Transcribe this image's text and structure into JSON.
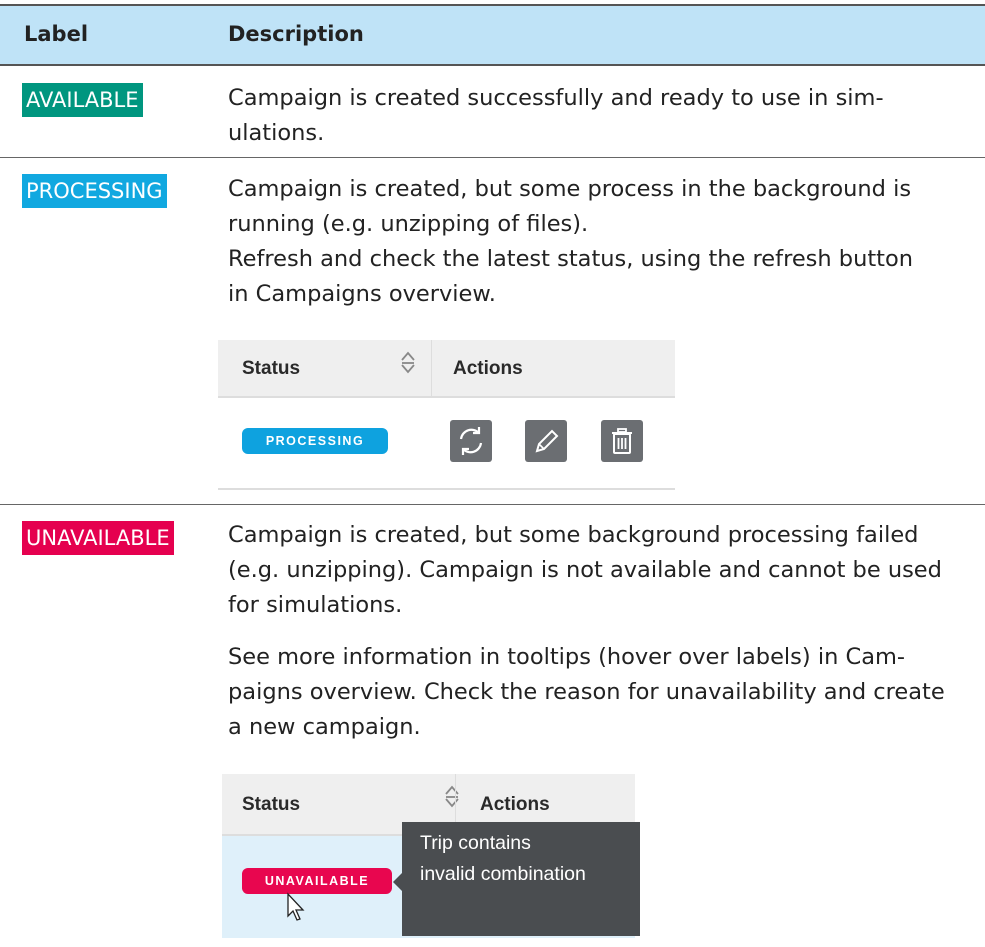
{
  "table": {
    "header": {
      "label": "Label",
      "description": "Description"
    },
    "rows": [
      {
        "label": "AVAILABLE",
        "color": "#00967f",
        "lines": [
          "Campaign is created successfully and ready to use in sim-",
          "ulations."
        ]
      },
      {
        "label": "PROCESSING",
        "color": "#11a8e0",
        "lines": [
          "Campaign is created, but some process in the background is",
          "running (e.g. unzipping of files).",
          "Refresh and check the latest status, using the refresh button",
          "in Campaigns overview."
        ],
        "screenshot": {
          "status_header": "Status",
          "actions_header": "Actions",
          "pill": "PROCESSING",
          "pill_color": "#0ea2df",
          "buttons": [
            "refresh-icon",
            "pencil-icon",
            "trash-icon"
          ]
        }
      },
      {
        "label": "UNAVAILABLE",
        "color": "#e5004f",
        "lines": [
          "Campaign is created, but some background processing failed",
          "(e.g. unzipping). Campaign is not available and cannot be used",
          "for simulations."
        ],
        "lines2": [
          "See more information in tooltips (hover over labels) in Cam-",
          "paigns overview. Check the reason for unavailability and create",
          "a new campaign."
        ],
        "screenshot": {
          "status_header": "Status",
          "actions_header": "Actions",
          "pill": "UNAVAILABLE",
          "pill_color": "#e8064f",
          "tooltip": [
            "Trip contains",
            "invalid combination"
          ]
        }
      }
    ]
  }
}
